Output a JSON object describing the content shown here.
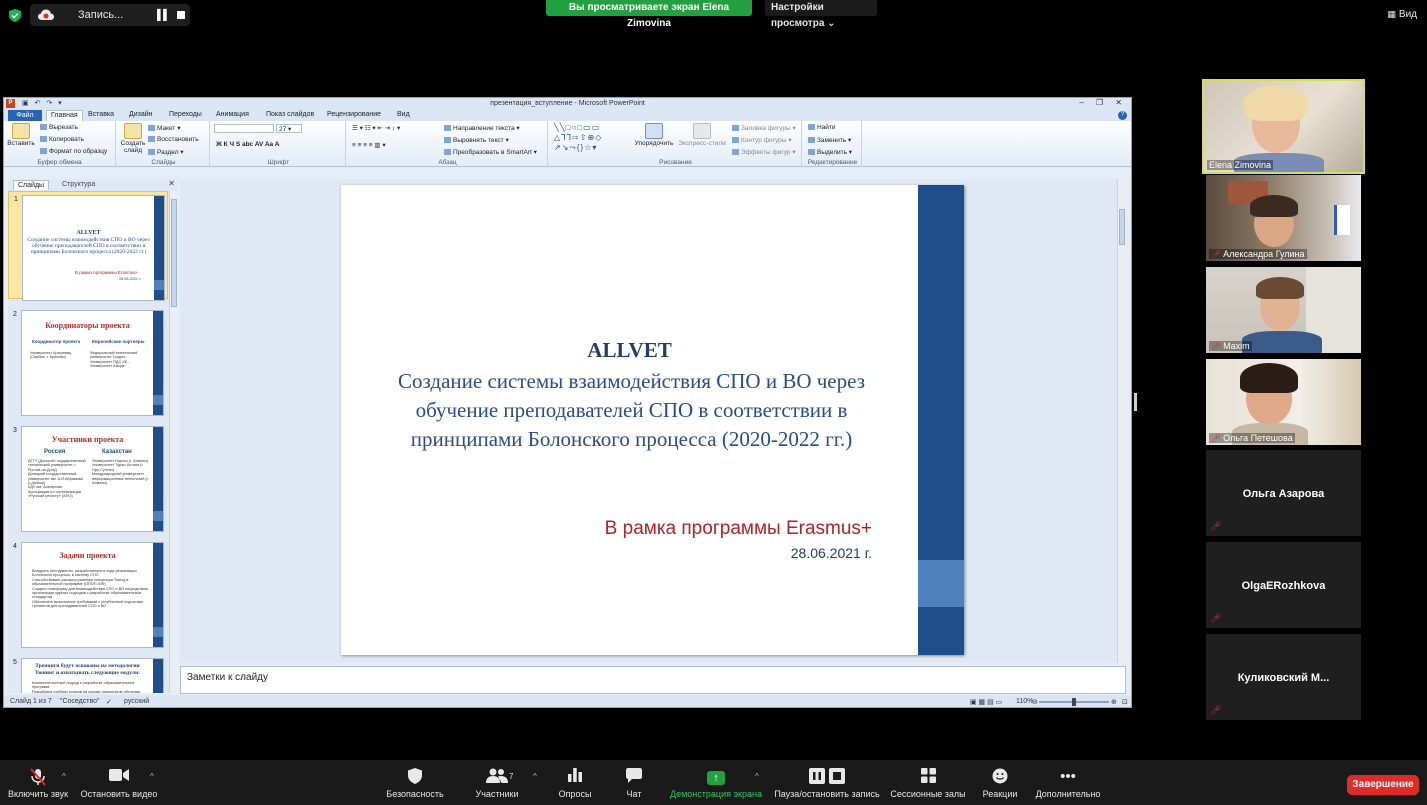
{
  "topbar": {
    "recording_label": "Запись...",
    "share_banner": "Вы просматриваете экран Elena Zimovina",
    "view_settings": "Настройки просмотра",
    "view_button": "Вид"
  },
  "ppt": {
    "window_title": "презентация_вступление - Microsoft PowerPoint",
    "tabs": [
      "Файл",
      "Главная",
      "Вставка",
      "Дизайн",
      "Переходы",
      "Анимация",
      "Показ слайдов",
      "Рецензирование",
      "Вид"
    ],
    "active_tab": "Главная",
    "ribbon": {
      "clipboard": {
        "group": "Буфер обмена",
        "paste": "Вставить",
        "cut": "Вырезать",
        "copy": "Копировать",
        "format_painter": "Формат по образцу"
      },
      "slides": {
        "group": "Слайды",
        "new_slide": "Создать слайд",
        "layout": "Макет",
        "reset": "Восстановить",
        "section": "Раздел"
      },
      "font": {
        "group": "Шрифт",
        "size": "27",
        "buttons": "Ж К Ч S abc AV Aa A"
      },
      "paragraph": {
        "group": "Абзац",
        "text_direction": "Направление текста",
        "align_text": "Выровнять текст",
        "smartart": "Преобразовать в SmartArt"
      },
      "drawing": {
        "group": "Рисование",
        "arrange": "Упорядочить",
        "quick_styles": "Экспресс-стили",
        "shape_fill": "Заливка фигуры",
        "shape_outline": "Контур фигуры",
        "shape_effects": "Эффекты фигур"
      },
      "editing": {
        "group": "Редактирование",
        "find": "Найти",
        "replace": "Заменить",
        "select": "Выделить"
      }
    },
    "pane_tabs": {
      "slides": "Слайды",
      "outline": "Структура"
    },
    "thumbnails": [
      {
        "num": "1",
        "title": "ALLVET",
        "subtitle": "Создание системы взаимодействия СПО и ВО через обучение преподавателей СПО в соответствии в принципами Болонского процесса (2020-2022 гг.)",
        "program": "В рамка программы Erasmus+",
        "date": "28.06.2021 г."
      },
      {
        "num": "2",
        "title": "Координаторы проекта",
        "col1": "Координатор проекта",
        "col2": "Европейские партнеры",
        "b1": "Университет Крагуевац (Сербия, г. Кралево)",
        "b2": "Федеральный технический университет Гродно...\nУниверситет ПДС ХЕ...\nУниверситет Шкоде"
      },
      {
        "num": "3",
        "title": "Участники проекта",
        "col1": "Россия",
        "col2": "Казахстан",
        "b1": "ДГТУ (Донской государственный технический университет, г. Ростов-на-Дону)\nДонецкий государственный университет им. А.И.Абрамова (г.Донецк)\nКДУ им. Агаларова\nАссоциация по сертификации «Русский регистр» (АНО)",
        "b2": "Университет Нархоз (г. Алматы)\nУниверситет Туран-Астана (г. Нур-Султан)\nМеждународный университет информационных технологий (г. Алматы)"
      },
      {
        "num": "4",
        "title": "Задачи проекта",
        "b1": "Внедрить инструменты, разработанные в ходе реализации Болонского процесса, в систему СПО\nСпособствовать распространению концепции Tuning в образовательной программе (ОПОП-ЮФ)\nСоздать платформу для взаимодействия СПО и ВО посредством организации единых подходов к разработке образовательных стандартов\nОбеспечить выполнение требований к углубленной подготовке тренингов для преподавателей СПО и ВО"
      },
      {
        "num": "5",
        "title": "Тренинги будут основаны на методологии Тюнинг и охватывать следующие модули:",
        "b1": "Компетентностный подход к разработке образовательных программ\nРазработка учебных планов на основе результатов обучения"
      }
    ],
    "main_slide": {
      "title": "ALLVET",
      "subtitle": "Создание системы взаимодействия СПО и ВО через обучение преподавателей СПО в соответствии в принципами Болонского процесса (2020-2022 гг.)",
      "program": "В рамка программы Erasmus+",
      "date": "28.06.2021 г."
    },
    "notes_placeholder": "Заметки к слайду",
    "status": {
      "slide": "Слайд 1 из 7",
      "theme": "\"Соседство\"",
      "language": "русский",
      "zoom": "110%"
    }
  },
  "participants": [
    {
      "name": "Elena Zimovina",
      "muted": false,
      "video": true,
      "active_speaker": true
    },
    {
      "name": "Александра Гулина",
      "muted": true,
      "video": true
    },
    {
      "name": "Maxim",
      "muted": true,
      "video": true
    },
    {
      "name": "Ольга Петешова",
      "muted": true,
      "video": true
    },
    {
      "name": "Ольга Азарова",
      "muted": true,
      "video": false
    },
    {
      "name": "OlgaERozhkova",
      "muted": true,
      "video": false
    },
    {
      "name": "Куликовский  М...",
      "muted": true,
      "video": false
    }
  ],
  "toolbar": {
    "unmute": "Включить звук",
    "stop_video": "Остановить видео",
    "security": "Безопасность",
    "participants": "Участники",
    "participants_count": "7",
    "polls": "Опросы",
    "chat": "Чат",
    "share_screen": "Демонстрация экрана",
    "pause_record": "Пауза/остановить запись",
    "breakout": "Сессионные залы",
    "reactions": "Реакции",
    "more": "Дополнительно",
    "end": "Завершение"
  },
  "colors": {
    "zoom_green": "#23a142",
    "zoom_red": "#e02b2b",
    "slide_navy": "#1f4e8a",
    "slide_light_blue": "#4f81bd",
    "slide_red_text": "#b0232a",
    "speaker_outline": "#d4e157"
  }
}
